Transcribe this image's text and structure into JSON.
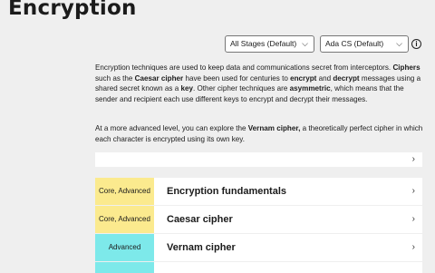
{
  "page": {
    "title": "Encryption"
  },
  "filters": {
    "stage_value": "All Stages (Default)",
    "language_value": "Ada CS (Default)"
  },
  "intro": {
    "p1_a": "Encryption techniques are used to keep data and communications secret from interceptors.",
    "p1_b": "Ciphers",
    "p1_c": " such as the ",
    "p1_d": "Caesar cipher",
    "p1_e": " have been used for centuries to ",
    "p1_f": "encrypt",
    "p1_g": " and ",
    "p1_h": "decrypt",
    "p1_i": " messages using a shared secret known as a ",
    "p1_j": "key",
    "p1_k": ". Other cipher techniques are ",
    "p1_l": "asymmetric",
    "p1_m": ", which means that the sender and recipient each use different keys to encrypt and decrypt their messages.",
    "p2_a": "At a more advanced level, you can explore the ",
    "p2_b": "Vernam cipher,",
    "p2_c": " a theoretically perfect cipher in which each character is encrypted using its own key."
  },
  "icons": {
    "chevron_down": "⌵",
    "chevron_right": "›",
    "info": "i"
  },
  "colors": {
    "core_advanced": "#fbea8e",
    "advanced": "#7de9ea"
  },
  "cards": [
    {
      "level": "Core, Advanced",
      "title": "Encryption fundamentals"
    },
    {
      "level": "Core, Advanced",
      "title": "Caesar cipher"
    },
    {
      "level": "Advanced",
      "title": "Vernam cipher"
    }
  ]
}
